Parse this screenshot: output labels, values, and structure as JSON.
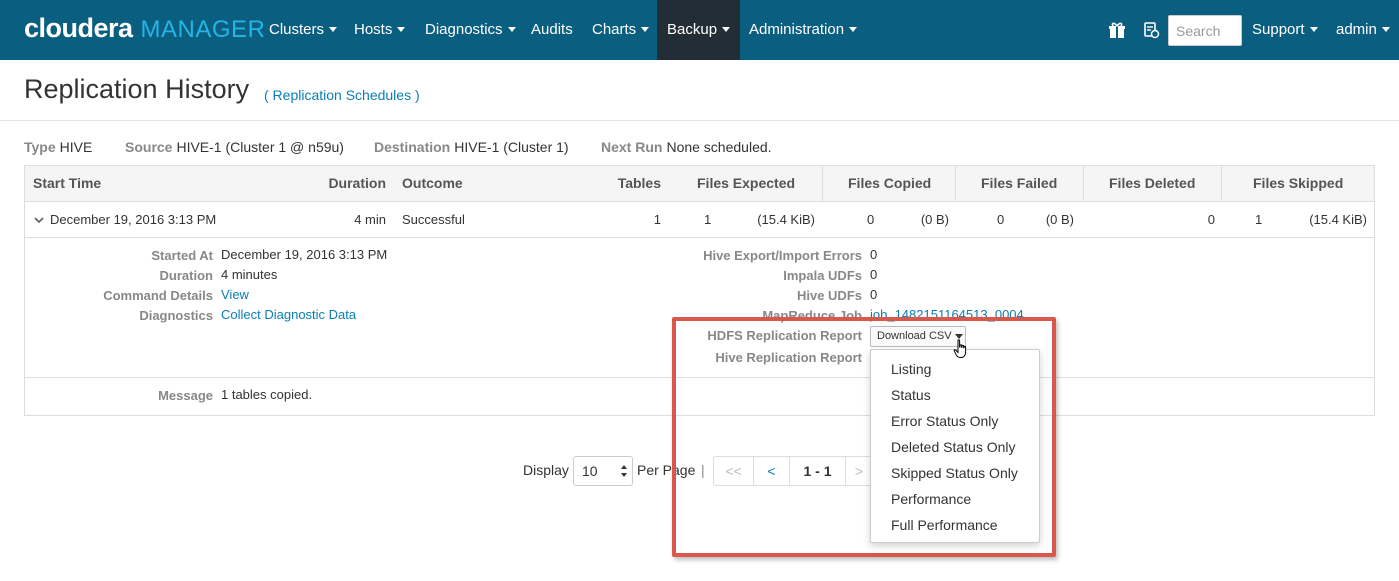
{
  "brand": {
    "logo_main": "cloudera",
    "logo_sub": "MANAGER"
  },
  "nav": {
    "items": [
      "Clusters",
      "Hosts",
      "Diagnostics",
      "Audits",
      "Charts",
      "Backup",
      "Administration"
    ],
    "active": "Backup",
    "search_placeholder": "Search",
    "support": "Support",
    "user": "admin"
  },
  "page": {
    "title": "Replication History",
    "schedules_link": "( Replication Schedules )"
  },
  "meta": {
    "type_label": "Type",
    "type_value": "HIVE",
    "source_label": "Source",
    "source_value": "HIVE-1 (Cluster 1 @ n59u)",
    "dest_label": "Destination",
    "dest_value": "HIVE-1 (Cluster 1)",
    "next_label": "Next Run",
    "next_value": "None scheduled."
  },
  "table": {
    "headers": [
      "Start Time",
      "Duration",
      "Outcome",
      "Tables",
      "Files Expected",
      "Files Copied",
      "Files Failed",
      "Files Deleted",
      "Files Skipped"
    ],
    "row": {
      "start_time": "December 19, 2016 3:13 PM",
      "duration": "4 min",
      "outcome": "Successful",
      "tables": "1",
      "files_expected": "1",
      "files_expected_size": "(15.4 KiB)",
      "files_copied": "0",
      "files_copied_size": "(0 B)",
      "files_failed": "0",
      "files_failed_size": "(0 B)",
      "files_deleted": "0",
      "files_skipped": "1",
      "files_skipped_size": "(15.4 KiB)"
    }
  },
  "details": {
    "started_at_label": "Started At",
    "started_at": "December 19, 2016 3:13 PM",
    "duration_label": "Duration",
    "duration": "4 minutes",
    "command_label": "Command Details",
    "command_link": "View",
    "diagnostics_label": "Diagnostics",
    "diagnostics_link": "Collect Diagnostic Data",
    "hive_errors_label": "Hive Export/Import Errors",
    "hive_errors": "0",
    "impala_udfs_label": "Impala UDFs",
    "impala_udfs": "0",
    "hive_udfs_label": "Hive UDFs",
    "hive_udfs": "0",
    "mapreduce_label": "MapReduce Job",
    "mapreduce_job": "job_1482151164513_0004",
    "hdfs_report_label": "HDFS Replication Report",
    "hive_report_label": "Hive Replication Report",
    "download_csv": "Download CSV",
    "message_label": "Message",
    "message": "1 tables copied."
  },
  "pagination": {
    "display_label": "Display",
    "per_page": "10",
    "per_page_label": "Per Page",
    "separator": "|",
    "first": "<<",
    "prev": "<",
    "range": "1 - 1",
    "next": ">"
  },
  "dropdown": {
    "items": [
      "Listing",
      "Status",
      "Error Status Only",
      "Deleted Status Only",
      "Skipped Status Only",
      "Performance",
      "Full Performance"
    ]
  },
  "colors": {
    "navbar": "#0a5f80",
    "active_nav": "#222d35",
    "link": "#0a7eb5",
    "highlight": "#d9574b"
  }
}
